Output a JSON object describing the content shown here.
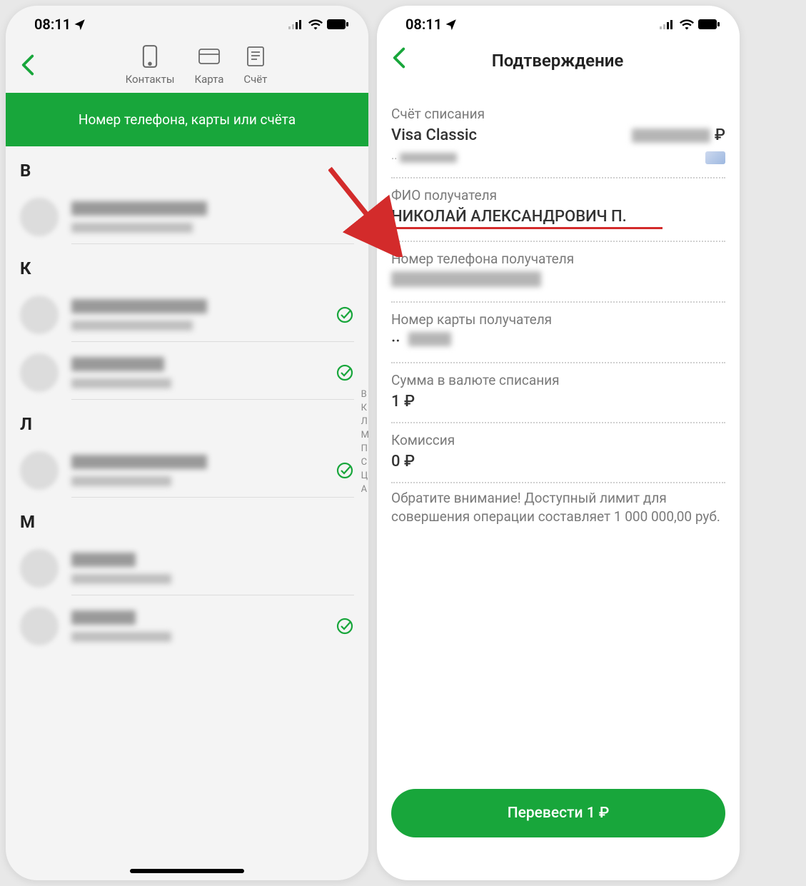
{
  "status": {
    "time": "08:11"
  },
  "left": {
    "tabs": {
      "contacts": "Контакты",
      "card": "Карта",
      "account": "Счёт"
    },
    "search_placeholder": "Номер телефона, карты или счёта",
    "sections": [
      "В",
      "К",
      "Л",
      "М"
    ],
    "alpha_index": [
      "В",
      "К",
      "Л",
      "М",
      "П",
      "С",
      "Ц",
      "А"
    ]
  },
  "right": {
    "title": "Подтверждение",
    "fields": {
      "source_account_label": "Счёт списания",
      "source_account_value": "Visa Classic",
      "ruble": "₽",
      "recipient_name_label": "ФИО получателя",
      "recipient_name_value": "НИКОЛАЙ АЛЕКСАНДРОВИЧ П.",
      "recipient_phone_label": "Номер телефона получателя",
      "recipient_card_label": "Номер карты получателя",
      "recipient_card_prefix": "··",
      "amount_label": "Сумма в валюте списания",
      "amount_value": "1 ₽",
      "fee_label": "Комиссия",
      "fee_value": "0 ₽"
    },
    "notice": "Обратите внимание! Доступный лимит для совершения операции составляет 1 000 000,00 руб.",
    "button": "Перевести 1 ₽"
  }
}
